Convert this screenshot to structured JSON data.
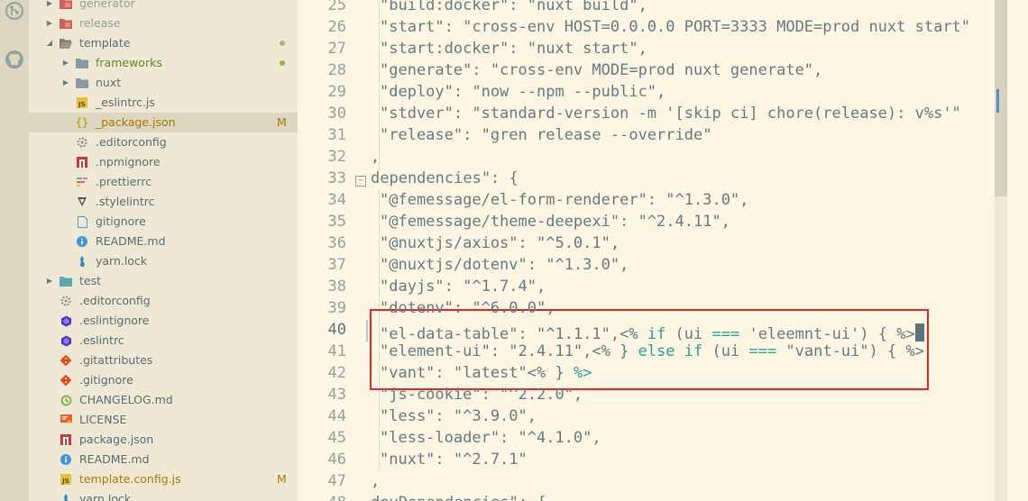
{
  "explorer": {
    "items": [
      {
        "label": "generator",
        "type": "folder-red",
        "twisty": "closed",
        "level": 1
      },
      {
        "label": "release",
        "type": "folder-red",
        "twisty": "closed",
        "level": 1
      },
      {
        "label": "template",
        "type": "folder-open",
        "twisty": "open",
        "level": 1,
        "decoration": "dot-brown"
      },
      {
        "label": "frameworks",
        "type": "folder",
        "twisty": "closed",
        "level": 2,
        "decoration": "dot-green",
        "color": "#5a8a1e"
      },
      {
        "label": "nuxt",
        "type": "folder",
        "twisty": "closed",
        "level": 2
      },
      {
        "label": "_eslintrc.js",
        "type": "js",
        "level": 2
      },
      {
        "label": "_package.json",
        "type": "json",
        "level": 2,
        "decoration": "M",
        "selected": true,
        "color": "#a87a00"
      },
      {
        "label": ".editorconfig",
        "type": "config",
        "level": 2
      },
      {
        "label": ".npmignore",
        "type": "npm",
        "level": 2
      },
      {
        "label": ".prettierrc",
        "type": "prettier",
        "level": 2
      },
      {
        "label": ".stylelintrc",
        "type": "stylelint",
        "level": 2
      },
      {
        "label": "gitignore",
        "type": "file",
        "level": 2
      },
      {
        "label": "README.md",
        "type": "info",
        "level": 2
      },
      {
        "label": "yarn.lock",
        "type": "yarn",
        "level": 2
      },
      {
        "label": "test",
        "type": "folder-test",
        "twisty": "closed",
        "level": 1
      },
      {
        "label": ".editorconfig",
        "type": "config",
        "level": 1
      },
      {
        "label": ".eslintignore",
        "type": "eslint",
        "level": 1
      },
      {
        "label": ".eslintrc",
        "type": "eslint",
        "level": 1
      },
      {
        "label": ".gitattributes",
        "type": "git",
        "level": 1
      },
      {
        "label": ".gitignore",
        "type": "git",
        "level": 1
      },
      {
        "label": "CHANGELOG.md",
        "type": "changelog",
        "level": 1
      },
      {
        "label": "LICENSE",
        "type": "license",
        "level": 1
      },
      {
        "label": "package.json",
        "type": "npm",
        "level": 1
      },
      {
        "label": "README.md",
        "type": "info",
        "level": 1
      },
      {
        "label": "template.config.js",
        "type": "js",
        "level": 1,
        "decoration": "M",
        "color": "#a87a00"
      },
      {
        "label": "yarn.lock",
        "type": "yarn",
        "level": 1
      }
    ]
  },
  "editor": {
    "active_line": "40",
    "lines": [
      {
        "num": "25",
        "text": "\"build:docker\": \"nuxt build\","
      },
      {
        "num": "26",
        "text": "\"start\": \"cross-env HOST=0.0.0.0 PORT=3333 MODE=prod nuxt start\""
      },
      {
        "num": "27",
        "text": "\"start:docker\": \"nuxt start\","
      },
      {
        "num": "28",
        "text": "\"generate\": \"cross-env MODE=prod nuxt generate\","
      },
      {
        "num": "29",
        "text": "\"deploy\": \"now --npm --public\","
      },
      {
        "num": "30",
        "text": "\"stdver\": \"standard-version -m '[skip ci] chore(release): v%s'\""
      },
      {
        "num": "31",
        "text": "\"release\": \"gren release --override\""
      },
      {
        "num": "32",
        "text": ","
      },
      {
        "num": "33",
        "text": "dependencies\": {",
        "fold": "−"
      },
      {
        "num": "34",
        "text": "\"@femessage/el-form-renderer\": \"^1.3.0\","
      },
      {
        "num": "35",
        "text": "\"@femessage/theme-deepexi\": \"^2.4.11\","
      },
      {
        "num": "36",
        "text": "\"@nuxtjs/axios\": \"^5.0.1\","
      },
      {
        "num": "37",
        "text": "\"@nuxtjs/dotenv\": \"^1.3.0\","
      },
      {
        "num": "38",
        "text": "\"dayjs\": \"^1.7.4\","
      },
      {
        "num": "39",
        "text": "\"dotenv\": \"^6.0.0\","
      },
      {
        "num": "40",
        "segments": [
          {
            "t": "\"el-data-table\": \"^1.1.1\",",
            "c": ""
          },
          {
            "t": "<% ",
            "c": ""
          },
          {
            "t": "if",
            "c": "kw"
          },
          {
            "t": " (ui ",
            "c": ""
          },
          {
            "t": "===",
            "c": "op"
          },
          {
            "t": " 'eleemnt-ui') { %>",
            "c": ""
          }
        ]
      },
      {
        "num": "41",
        "segments": [
          {
            "t": "\"element-ui\": \"2.4.11\",",
            "c": ""
          },
          {
            "t": "<% } ",
            "c": ""
          },
          {
            "t": "else",
            "c": "kw"
          },
          {
            "t": " ",
            "c": ""
          },
          {
            "t": "if",
            "c": "kw"
          },
          {
            "t": " (ui ",
            "c": ""
          },
          {
            "t": "===",
            "c": "op"
          },
          {
            "t": " \"vant-ui\") { %>",
            "c": ""
          }
        ]
      },
      {
        "num": "42",
        "segments": [
          {
            "t": "\"vant\": \"latest\"",
            "c": ""
          },
          {
            "t": "<% } ",
            "c": ""
          },
          {
            "t": "%>",
            "c": "kw"
          }
        ]
      },
      {
        "num": "43",
        "text": "\"js-cookie\": \"^2.2.0\","
      },
      {
        "num": "44",
        "text": "\"less\": \"^3.9.0\","
      },
      {
        "num": "45",
        "text": "\"less-loader\": \"^4.1.0\","
      },
      {
        "num": "46",
        "text": "\"nuxt\": \"^2.7.1\""
      },
      {
        "num": "47",
        "text": ","
      },
      {
        "num": "48",
        "text": "devDependencies\": {"
      }
    ]
  },
  "colors": {
    "highlight_box": "#e02828",
    "modified": "#a87a00",
    "untracked": "#5a8a1e"
  }
}
